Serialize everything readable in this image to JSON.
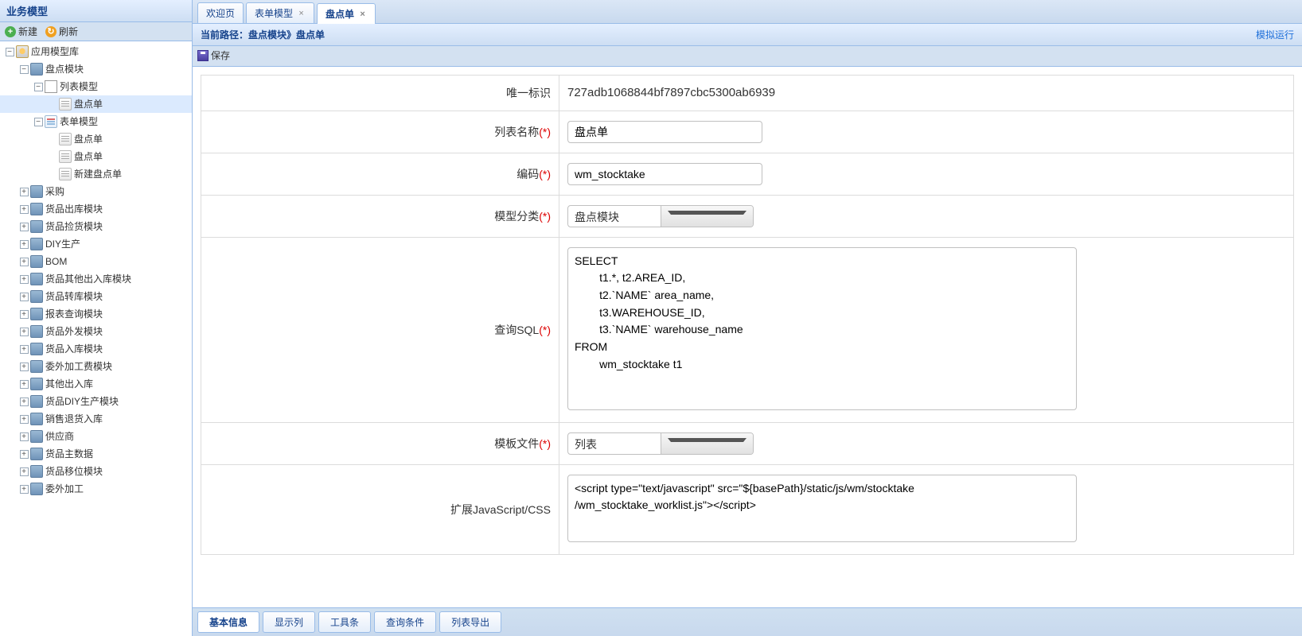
{
  "west": {
    "title": "业务模型",
    "toolbar": {
      "new": "新建",
      "refresh": "刷新"
    },
    "tree": {
      "root": "应用模型库",
      "inventory_module": "盘点模块",
      "list_model": "列表模型",
      "list_model_leaf": "盘点单",
      "form_model": "表单模型",
      "form_leaves": [
        "盘点单",
        "盘点单",
        "新建盘点单"
      ],
      "others": [
        "采购",
        "货品出库模块",
        "货品捡货模块",
        "DIY生产",
        "BOM",
        "货品其他出入库模块",
        "货品转库模块",
        "报表查询模块",
        "货品外发模块",
        "货品入库模块",
        "委外加工费模块",
        "其他出入库",
        "货品DIY生产模块",
        "销售退货入库",
        "供应商",
        "货品主数据",
        "货品移位模块",
        "委外加工"
      ]
    }
  },
  "tabs": [
    {
      "label": "欢迎页",
      "closable": false
    },
    {
      "label": "表单模型",
      "closable": true
    },
    {
      "label": "盘点单",
      "closable": true,
      "active": true
    }
  ],
  "pathbar": {
    "prefix": "当前路径：",
    "path": "盘点模块》盘点单",
    "action": "模拟运行"
  },
  "save_label": "保存",
  "form": {
    "uid": {
      "label": "唯一标识",
      "value": "727adb1068844bf7897cbc5300ab6939"
    },
    "name": {
      "label": "列表名称",
      "req": "(*)",
      "value": "盘点单"
    },
    "code": {
      "label": "编码",
      "req": "(*)",
      "value": "wm_stocktake"
    },
    "category": {
      "label": "模型分类",
      "req": "(*)",
      "value": "盘点模块"
    },
    "sql": {
      "label": "查询SQL",
      "req": "(*)",
      "value": "SELECT\n        t1.*, t2.AREA_ID,\n        t2.`NAME` area_name,\n        t3.WAREHOUSE_ID,\n        t3.`NAME` warehouse_name\nFROM\n        wm_stocktake t1"
    },
    "template": {
      "label": "模板文件",
      "req": "(*)",
      "value": "列表"
    },
    "jscss": {
      "label": "扩展JavaScript/CSS",
      "value": "<script type=\"text/javascript\" src=\"${basePath}/static/js/wm/stocktake\n/wm_stocktake_worklist.js\"></script>"
    }
  },
  "bottom_tabs": [
    "基本信息",
    "显示列",
    "工具条",
    "查询条件",
    "列表导出"
  ]
}
